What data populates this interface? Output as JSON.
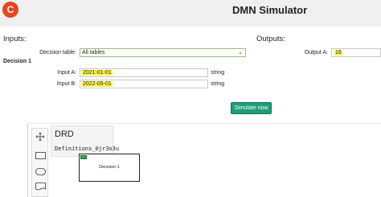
{
  "header": {
    "logo_text": "C",
    "title": "DMN Simulator"
  },
  "inputs": {
    "section_label": "Inputs:",
    "decision_table": {
      "label": "Decision table:",
      "selected": "All tables"
    },
    "decision_heading": "Decision 1",
    "fields": [
      {
        "label": "Input A:",
        "value": "2021-01-01",
        "type": "string"
      },
      {
        "label": "Input B:",
        "value": "2022-05-01",
        "type": "string"
      }
    ],
    "simulate_label": "Simulate now"
  },
  "outputs": {
    "section_label": "Outputs:",
    "fields": [
      {
        "label": "Output A:",
        "value": "16"
      }
    ]
  },
  "drd": {
    "title": "DRD",
    "definitions_id": "Definitions_0jr3o3u",
    "decision_label": "Decision 1"
  },
  "icons": {
    "logo": "app-logo",
    "select_chevron": "chevron-down-icon",
    "hand_tool": "hand-tool-icon",
    "decision_tool": "decision-tool-icon",
    "input_data_tool": "input-data-tool-icon",
    "knowledge_source_tool": "knowledge-source-tool-icon",
    "decision_table_marker": "decision-table-icon"
  },
  "colors": {
    "accent": "#1f9e7a",
    "highlight": "#fff84a",
    "logo": "#e8441e"
  }
}
